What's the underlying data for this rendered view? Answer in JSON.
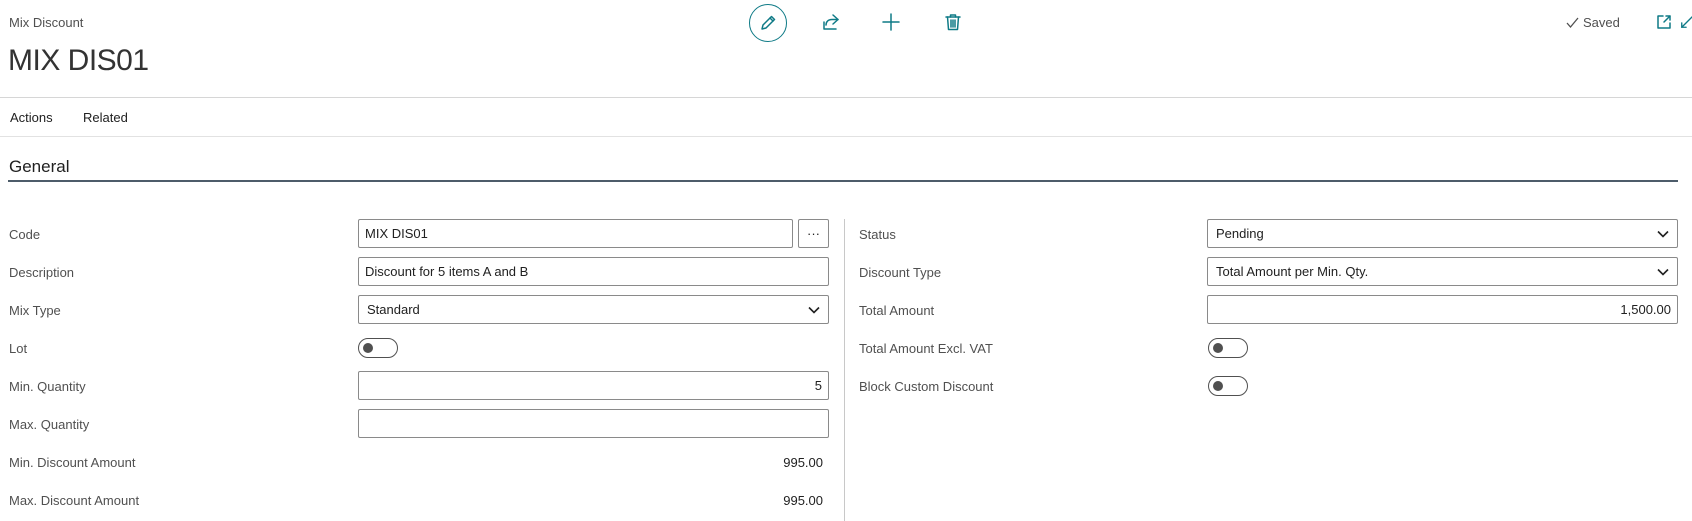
{
  "header": {
    "breadcrumb": "Mix Discount",
    "title": "MIX DIS01",
    "saved_label": "Saved",
    "icons": [
      "edit-icon",
      "share-icon",
      "add-icon",
      "delete-icon",
      "checkmark-icon",
      "open-in-new-window-icon",
      "collapse-icon"
    ]
  },
  "menu": {
    "actions": "Actions",
    "related": "Related"
  },
  "section": {
    "title": "General"
  },
  "left": {
    "code": {
      "label": "Code",
      "value": "MIX DIS01",
      "lookup": "···"
    },
    "description": {
      "label": "Description",
      "value": "Discount for 5 items A and B"
    },
    "mix_type": {
      "label": "Mix Type",
      "value": "Standard"
    },
    "lot": {
      "label": "Lot",
      "checked": false
    },
    "min_quantity": {
      "label": "Min. Quantity",
      "value": "5"
    },
    "max_quantity": {
      "label": "Max. Quantity",
      "value": ""
    },
    "min_discount_amount": {
      "label": "Min. Discount Amount",
      "value": "995.00"
    },
    "max_discount_amount": {
      "label": "Max. Discount Amount",
      "value": "995.00"
    }
  },
  "right": {
    "status": {
      "label": "Status",
      "value": "Pending"
    },
    "discount_type": {
      "label": "Discount Type",
      "value": "Total Amount per Min. Qty."
    },
    "total_amount": {
      "label": "Total Amount",
      "value": "1,500.00"
    },
    "total_amount_excl_vat": {
      "label": "Total Amount Excl. VAT",
      "checked": false
    },
    "block_custom_discount": {
      "label": "Block Custom Discount",
      "checked": false
    }
  },
  "colors": {
    "accent": "#0e7a86",
    "section_line": "#4d5c6a",
    "text": "#212121",
    "muted": "#505050"
  }
}
